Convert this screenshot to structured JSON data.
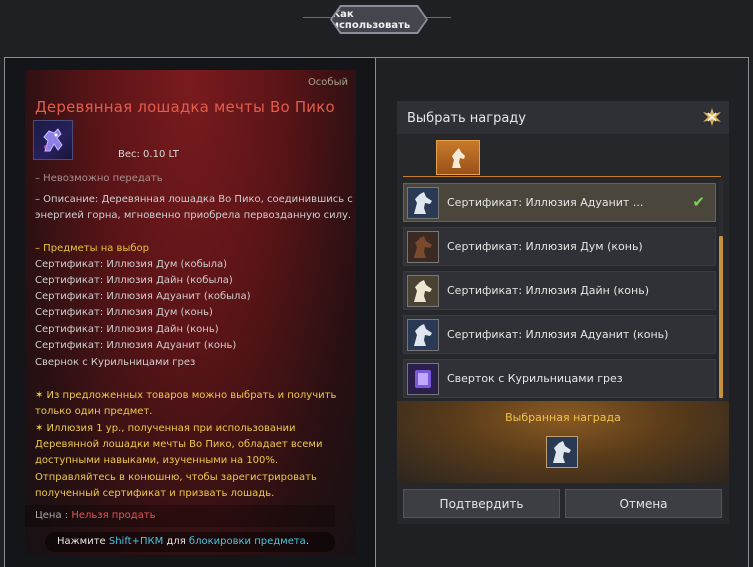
{
  "top_bar": {
    "how_to_use_label": "Как использовать"
  },
  "tooltip": {
    "grade": "Особый",
    "title": "Деревянная лошадка мечты Во Пико",
    "weight": "Вес:   0.10 LT",
    "untradable": "– Невозможно передать",
    "description": [
      "– Описание: Деревянная лошадка Во Пико, соединившись с",
      "энергией горна, мгновенно приобрела первозданную силу."
    ],
    "choices_header": "– Предметы на выбор",
    "choices": [
      "Сертификат: Иллюзия Дум (кобыла)",
      "Сертификат: Иллюзия Дайн (кобыла)",
      "Сертификат: Иллюзия Адуанит (кобыла)",
      "Сертификат: Иллюзия Дум (конь)",
      "Сертификат: Иллюзия Дайн (конь)",
      "Сертификат: Иллюзия Адуанит (конь)",
      "Свернок с Курильницами грез"
    ],
    "notes": [
      "✶ Из предложенных товаров можно выбрать и получить",
      "только один предмет.",
      "✶ Иллюзия 1 ур., полученная при использовании",
      "Деревянной лошадки мечты Во Пико, обладает всеми",
      "доступными навыками, изученными на 100%.",
      "Отправляйтесь в конюшню, чтобы зарегистрировать",
      "полученный сертификат и призвать лошадь."
    ],
    "price_label": "Цена :",
    "price_value": "Нельзя продать",
    "hint_prefix": "Нажмите ",
    "hint_key": "Shift+ПКМ",
    "hint_middle": " для ",
    "hint_action": "блокировки предмета",
    "hint_suffix": "."
  },
  "reward_window": {
    "title": "Выбрать награду",
    "items": [
      {
        "label": "Сертификат: Иллюзия Адуанит ...",
        "icon": "white-horse-icon",
        "selected": true
      },
      {
        "label": "Сертификат: Иллюзия Дум (конь)",
        "icon": "brown-horse-icon",
        "selected": false
      },
      {
        "label": "Сертификат: Иллюзия Дайн (конь)",
        "icon": "white-horse-icon",
        "selected": false
      },
      {
        "label": "Сертификат: Иллюзия Адуанит (конь)",
        "icon": "white-horse-icon",
        "selected": false
      },
      {
        "label": "Сверток с Курильницами грез",
        "icon": "incense-scroll-icon",
        "selected": false
      }
    ],
    "selected_reward_label": "Выбранная награда",
    "confirm_label": "Подтвердить",
    "cancel_label": "Отмена"
  },
  "colors": {
    "accent_orange": "#c57b2a",
    "title_red": "#e45c4c",
    "note_yellow": "#e8c53a",
    "check_green": "#7fd05a"
  }
}
